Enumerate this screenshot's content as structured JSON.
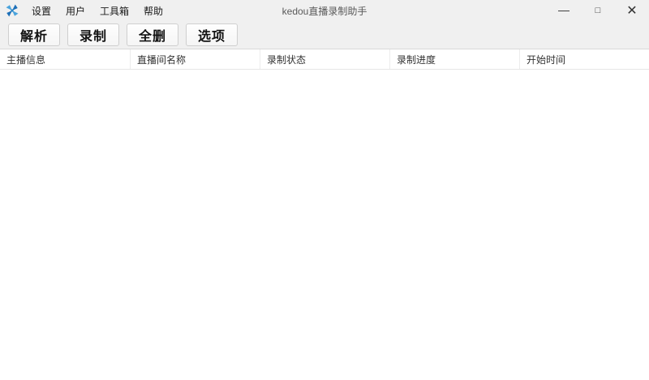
{
  "window": {
    "title": "kedou直播录制助手",
    "controls": {
      "minimize_glyph": "—",
      "maximize_glyph": "□",
      "close_glyph": "✕"
    }
  },
  "menu": {
    "items": [
      {
        "label": "设置"
      },
      {
        "label": "用户"
      },
      {
        "label": "工具箱"
      },
      {
        "label": "帮助"
      }
    ]
  },
  "toolbar": {
    "buttons": [
      {
        "label": "解析"
      },
      {
        "label": "录制"
      },
      {
        "label": "全删"
      },
      {
        "label": "选项"
      }
    ]
  },
  "table": {
    "columns": [
      {
        "label": "主播信息"
      },
      {
        "label": "直播间名称"
      },
      {
        "label": "录制状态"
      },
      {
        "label": "录制进度"
      },
      {
        "label": "开始时间"
      }
    ],
    "rows": []
  },
  "colors": {
    "chrome_bg": "#f0f0f0",
    "body_bg": "#ffffff",
    "border": "#d9d9d9",
    "header_divider": "#ececec",
    "icon_blue_dark": "#1c6fb8",
    "icon_blue_light": "#4aa3dc"
  }
}
